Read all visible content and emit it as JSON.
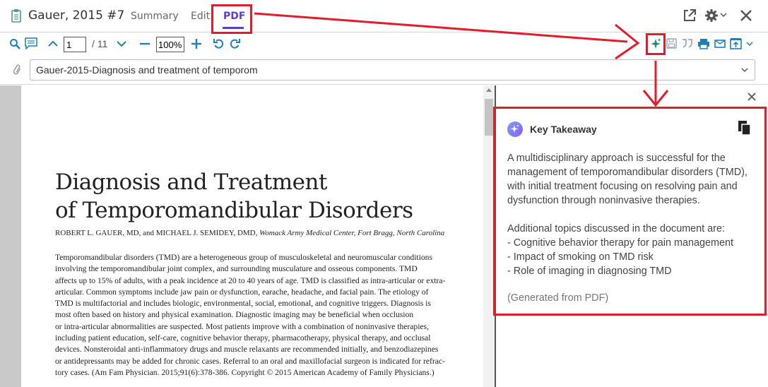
{
  "header": {
    "title": "Gauer, 2015 #7",
    "tabs": [
      {
        "label": "Summary"
      },
      {
        "label": "Edit"
      },
      {
        "label": "PDF"
      }
    ]
  },
  "toolbar": {
    "page_value": "1",
    "page_total": "/ 11",
    "zoom_value": "100%"
  },
  "attachment": {
    "selected": "Gauer-2015-Diagnosis and treatment of temporom"
  },
  "pdf": {
    "title_line1": "Diagnosis and Treatment",
    "title_line2": "of Temporomandibular Disorders",
    "authors_plain": "ROBERT L. GAUER, MD, and MICHAEL J. SEMIDEY, DMD, ",
    "authors_affiliation": "Womack Army Medical Center, Fort Bragg, North Carolina",
    "abstract_lines": [
      "Temporomandibular disorders (TMD) are a heterogeneous group of musculoskeletal and neuromuscular conditions",
      "involving the temporomandibular joint complex, and surrounding musculature and osseous components. TMD",
      "affects up to 15% of adults, with a peak incidence at 20 to 40 years of age. TMD is classified as intra-articular or extra-",
      "articular. Common symptoms include jaw pain or dysfunction, earache, headache, and facial pain. The etiology of",
      "TMD is multifactorial and includes biologic, environmental, social, emotional, and cognitive triggers. Diagnosis is",
      "most often based on history and physical examination. Diagnostic imaging may be beneficial when occlusion",
      "or intra-articular abnormalities are suspected. Most patients improve with a combination of noninvasive therapies,",
      "including patient education, self-care, cognitive behavior therapy, pharmacotherapy, physical therapy, and occlusal",
      "devices. Nonsteroidal anti-inflammatory drugs and muscle relaxants are recommended initially, and benzodiazepines",
      "or antidepressants may be added for chronic cases. Referral to an oral and maxillofacial surgeon is indicated for refrac-",
      "tory cases. (Am Fam Physician. 2015;91(6):378-386. Copyright © 2015 American Academy of Family Physicians.)"
    ]
  },
  "panel": {
    "title": "Key Takeaway",
    "paragraph": "A multidisciplinary approach is successful for the management of temporomandibular disorders (TMD), with initial treatment focusing on resolving pain and dysfunction through noninvasive therapies.",
    "topics_intro": "Additional topics discussed in the document are:",
    "topics": [
      "- Cognitive behavior therapy for pain management",
      "- Impact of smoking on TMD risk",
      "- Role of imaging in diagnosing TMD"
    ],
    "generated_note": "(Generated from PDF)"
  },
  "colors": {
    "accent": "#5b3fc7",
    "toolbar_blue": "#1e7fb8",
    "annotation_red": "#e01e2b"
  },
  "icons": [
    "clipboard-icon",
    "external-link-icon",
    "gear-icon",
    "close-icon",
    "search-icon",
    "comment-icon",
    "chevron-up-icon",
    "chevron-down-icon",
    "minus-icon",
    "plus-icon",
    "undo-icon",
    "redo-icon",
    "ai-sparkle-icon",
    "save-icon",
    "quote-icon",
    "print-icon",
    "email-icon",
    "export-icon",
    "paperclip-icon",
    "copy-icon"
  ]
}
